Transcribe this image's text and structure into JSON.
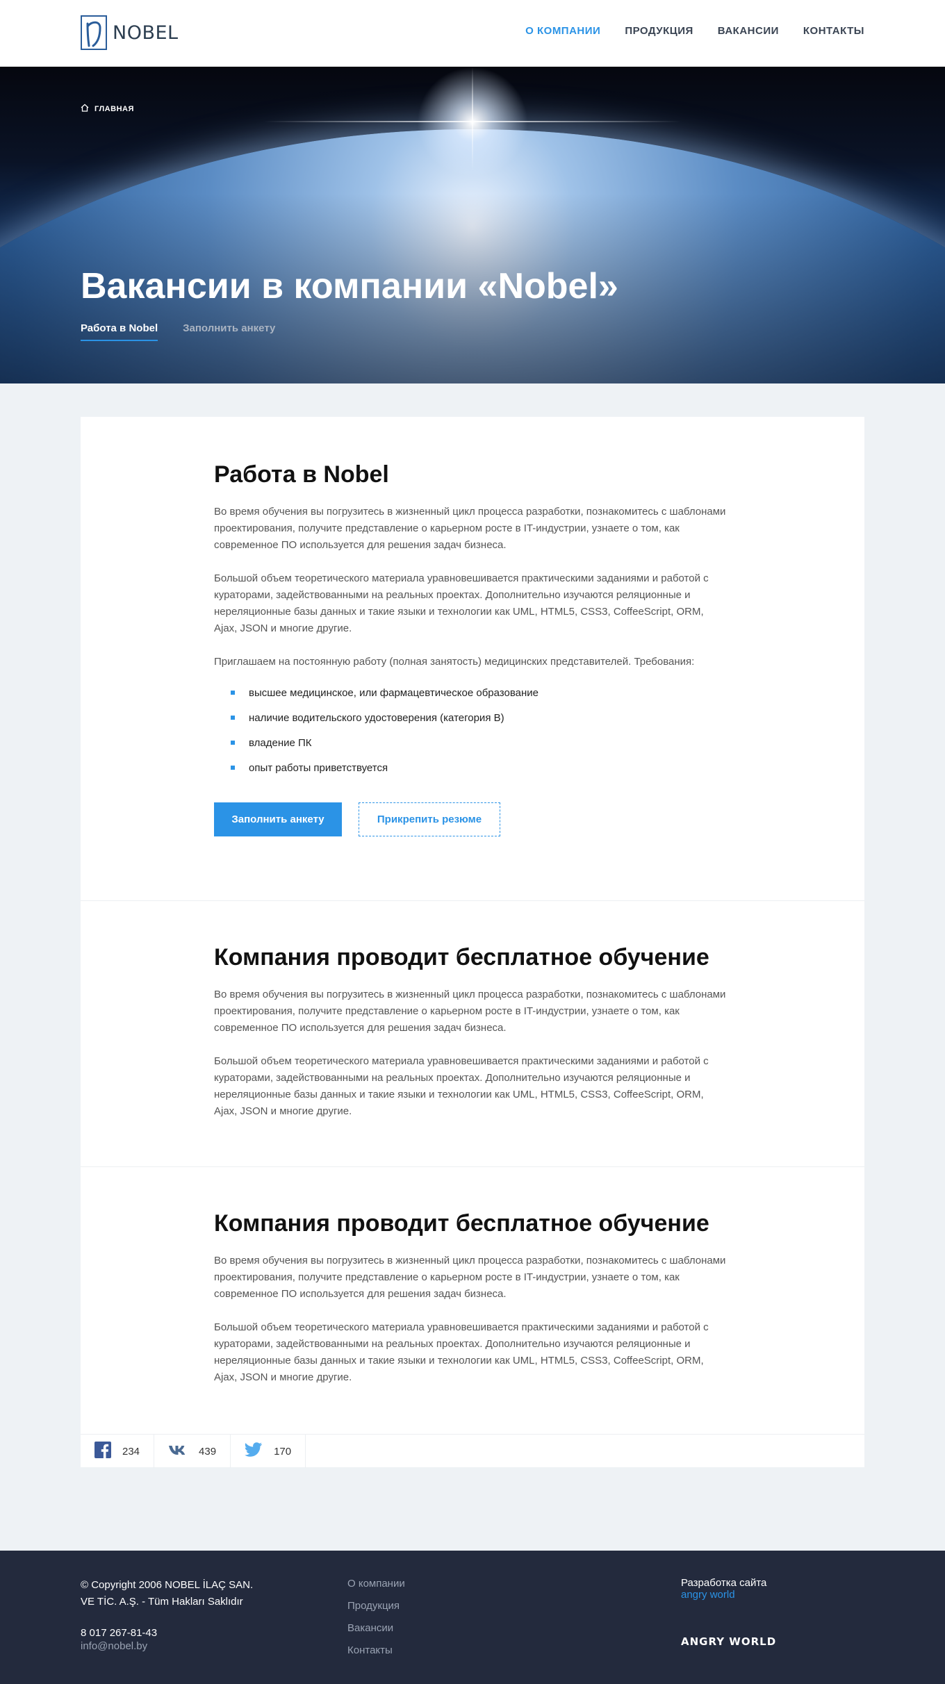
{
  "header": {
    "logo_text": "NOBEL",
    "nav": [
      {
        "label": "О КОМПАНИИ",
        "active": true
      },
      {
        "label": "ПРОДУКЦИЯ",
        "active": false
      },
      {
        "label": "ВАКАНСИИ",
        "active": false
      },
      {
        "label": "КОНТАКТЫ",
        "active": false
      }
    ]
  },
  "hero": {
    "breadcrumb": "ГЛАВНАЯ",
    "title": "Вакансии в компании «Nobel»",
    "tabs": [
      {
        "label": "Работа в Nobel",
        "active": true
      },
      {
        "label": "Заполнить анкету",
        "active": false
      }
    ]
  },
  "section1": {
    "title": "Работа в Nobel",
    "p1": "Во время обучения вы погрузитесь в жизненный цикл процесса разработки, познакомитесь с шаблонами проектирования, получите представление о карьерном росте в IT-индустрии, узнаете о том, как современное ПО используется для решения задач бизнеса.",
    "p2": "Большой объем теоретического материала уравновешивается практическими заданиями и работой с кураторами, задействованными на реальных проектах. Дополнительно изучаются реляционные и нереляционные базы данных и такие языки и технологии как UML, HTML5, CSS3, CoffeeScript, ORM, Ajax, JSON и многие другие.",
    "p3": "Приглашаем на постоянную работу (полная занятость) медицинских представителей. Требования:",
    "requirements": [
      "высшее медицинское, или фармацевтическое образование",
      "наличие водительского удостоверения (категория B)",
      "владение ПК",
      "опыт работы приветствуется"
    ],
    "btn_primary": "Заполнить анкету",
    "btn_secondary": "Прикрепить резюме"
  },
  "section2": {
    "title": "Компания проводит бесплатное обучение",
    "p1": "Во время обучения вы погрузитесь в жизненный цикл процесса разработки, познакомитесь с шаблонами проектирования, получите представление о карьерном росте в IT-индустрии, узнаете о том, как современное ПО используется для решения задач бизнеса.",
    "p2": "Большой объем теоретического материала уравновешивается практическими заданиями и работой с кураторами, задействованными на реальных проектах. Дополнительно изучаются реляционные и нереляционные базы данных и такие языки и технологии как UML, HTML5, CSS3, CoffeeScript, ORM, Ajax, JSON и многие другие."
  },
  "section3": {
    "title": "Компания проводит бесплатное обучение",
    "p1": "Во время обучения вы погрузитесь в жизненный цикл процесса разработки, познакомитесь с шаблонами проектирования, получите представление о карьерном росте в IT-индустрии, узнаете о том, как современное ПО используется для решения задач бизнеса.",
    "p2": "Большой объем теоретического материала уравновешивается практическими заданиями и работой с кураторами, задействованными на реальных проектах. Дополнительно изучаются реляционные и нереляционные базы данных и такие языки и технологии как UML, HTML5, CSS3, CoffeeScript, ORM, Ajax, JSON и многие другие."
  },
  "share": [
    {
      "icon": "facebook-icon",
      "count": "234"
    },
    {
      "icon": "vk-icon",
      "count": "439"
    },
    {
      "icon": "twitter-icon",
      "count": "170"
    }
  ],
  "footer": {
    "copyright_line1": "© Copyright 2006 NOBEL İLAÇ SAN.",
    "copyright_line2": "VE TİC. A.Ş. - Tüm Hakları Saklıdır",
    "phone": "8 017 267-81-43",
    "email": "info@nobel.by",
    "links": [
      "О компании",
      "Продукция",
      "Вакансии",
      "Контакты"
    ],
    "dev_label": "Разработка сайта",
    "dev_link": "angry world",
    "brand": "ANGRY WORLD"
  },
  "colors": {
    "accent": "#2b93e6",
    "footer_bg": "#232a3d",
    "page_bg": "#eef2f5"
  }
}
